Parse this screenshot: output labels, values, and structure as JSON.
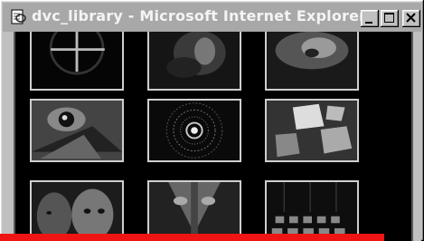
{
  "window": {
    "title": "dvc_library - Microsoft Internet Explorer",
    "icon": "ie-page-icon"
  },
  "title_buttons": [
    {
      "name": "minimize",
      "icon": "minimize-icon"
    },
    {
      "name": "maximize",
      "icon": "maximize-icon"
    },
    {
      "name": "close",
      "icon": "close-icon"
    }
  ],
  "gallery": {
    "thumbnails": [
      {
        "subject": "cross-lines"
      },
      {
        "subject": "dark-figure"
      },
      {
        "subject": "smoke-swirl"
      },
      {
        "subject": "eye-closeup"
      },
      {
        "subject": "radial-target"
      },
      {
        "subject": "floating-cubes"
      },
      {
        "subject": "two-faces"
      },
      {
        "subject": "mirrored-face"
      },
      {
        "subject": "tiled-grid"
      }
    ]
  },
  "colors": {
    "titlebar": "#a8a8a8",
    "content_background": "#000000",
    "thumb_border": "#cfcfcf",
    "red_bar": "#f01414"
  }
}
